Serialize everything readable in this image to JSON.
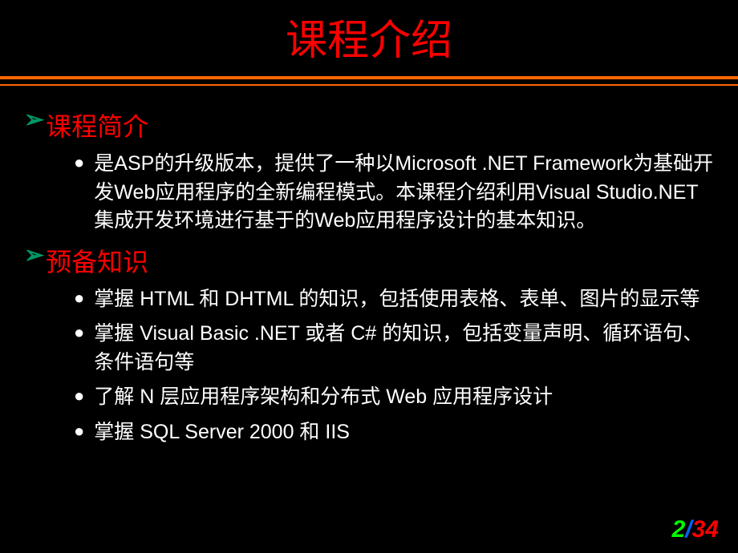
{
  "title": "课程介绍",
  "sections": [
    {
      "heading": "课程简介",
      "items": [
        "是ASP的升级版本，提供了一种以Microsoft .NET Framework为基础开发Web应用程序的全新编程模式。本课程介绍利用Visual Studio.NET 集成开发环境进行基于的Web应用程序设计的基本知识。"
      ]
    },
    {
      "heading": "预备知识",
      "items": [
        "掌握 HTML 和 DHTML 的知识，包括使用表格、表单、图片的显示等",
        "掌握 Visual Basic .NET 或者 C# 的知识，包括变量声明、循环语句、条件语句等",
        "了解 N 层应用程序架构和分布式 Web 应用程序设计",
        "掌握 SQL Server 2000 和 IIS"
      ]
    }
  ],
  "pageNumber": {
    "current": "2",
    "separator": "/",
    "total": "34"
  }
}
